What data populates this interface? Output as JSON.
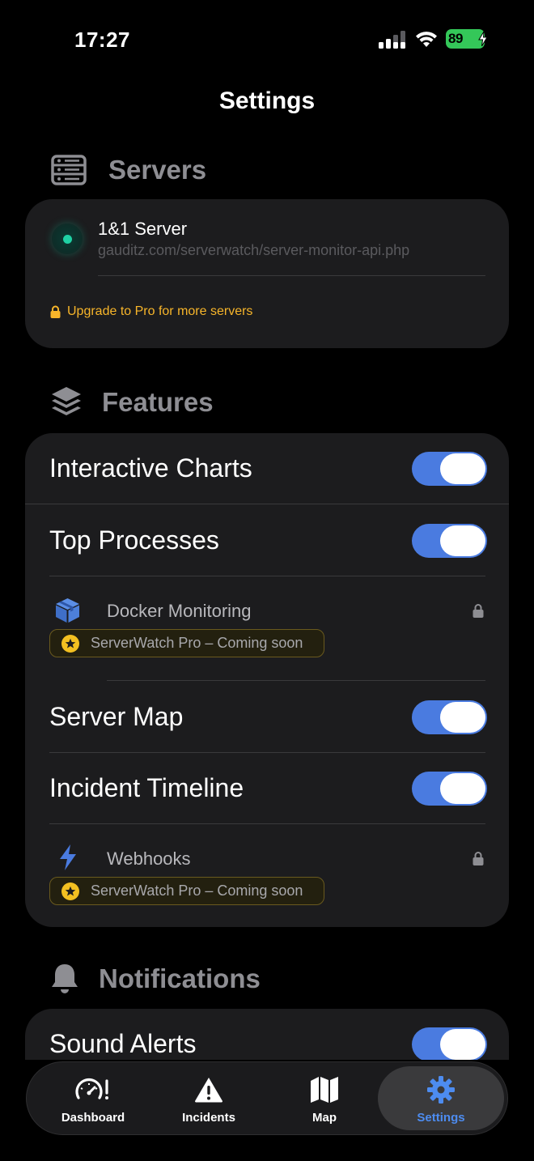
{
  "status_bar": {
    "time": "17:27",
    "battery": "89"
  },
  "page": {
    "title": "Settings"
  },
  "servers": {
    "title": "Servers",
    "items": [
      {
        "name": "1&1 Server",
        "url": "gauditz.com/serverwatch/server-monitor-api.php",
        "status_color": "#1fd1a4"
      }
    ],
    "upgrade_label": "Upgrade to Pro for more servers"
  },
  "features": {
    "title": "Features",
    "interactive_charts": {
      "label": "Interactive Charts",
      "enabled": true
    },
    "top_processes": {
      "label": "Top Processes",
      "enabled": true
    },
    "docker": {
      "label": "Docker Monitoring",
      "badge": "ServerWatch Pro – Coming soon",
      "locked": true
    },
    "server_map": {
      "label": "Server Map",
      "enabled": true
    },
    "incident_timeline": {
      "label": "Incident Timeline",
      "enabled": true
    },
    "webhooks": {
      "label": "Webhooks",
      "badge": "ServerWatch Pro – Coming soon",
      "locked": true
    }
  },
  "notifications": {
    "title": "Notifications",
    "sound_alerts": {
      "label": "Sound Alerts",
      "enabled": true
    }
  },
  "tab_bar": {
    "tabs": [
      {
        "label": "Dashboard",
        "icon": "gauge-alert-icon"
      },
      {
        "label": "Incidents",
        "icon": "warning-triangle-icon"
      },
      {
        "label": "Map",
        "icon": "map-icon"
      },
      {
        "label": "Settings",
        "icon": "gear-icon",
        "active": true
      }
    ]
  },
  "colors": {
    "accent": "#4d8cf0",
    "toggle_on": "#4a7be0",
    "pro": "#f3c021",
    "warning": "#f7b52a"
  }
}
